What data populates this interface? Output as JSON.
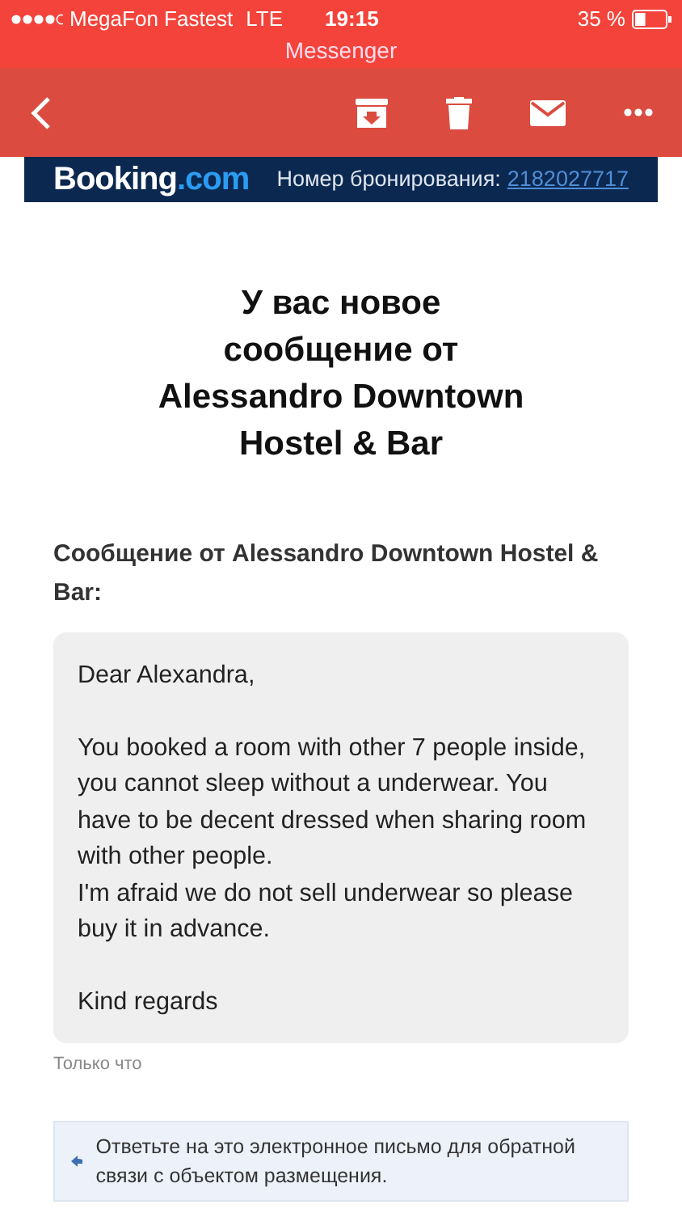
{
  "status_bar": {
    "carrier": "MegaFon Fastest",
    "network": "LTE",
    "time": "19:15",
    "battery": "35 %"
  },
  "app_title": "Messenger",
  "banner": {
    "logo_name": "Booking",
    "logo_suffix": ".com",
    "booking_label": "Номер бронирования:",
    "booking_number": "2182027717"
  },
  "heading": "У вас новое сообщение от Alessandro Downtown Hostel & Bar",
  "sender_label": "Сообщение от Alessandro Downtown Hostel & Bar:",
  "message": [
    [
      "Dear Alexandra,"
    ],
    [
      "You booked a room with other 7 people inside, you cannot sleep without a underwear. You have to be decent dressed when sharing room with other people.",
      "I'm afraid we do not sell underwear so please buy it in advance."
    ],
    [
      "Kind regards"
    ]
  ],
  "timestamp": "Только что",
  "reply_note": "Ответьте на это электронное письмо для обратной связи с объектом размещения."
}
